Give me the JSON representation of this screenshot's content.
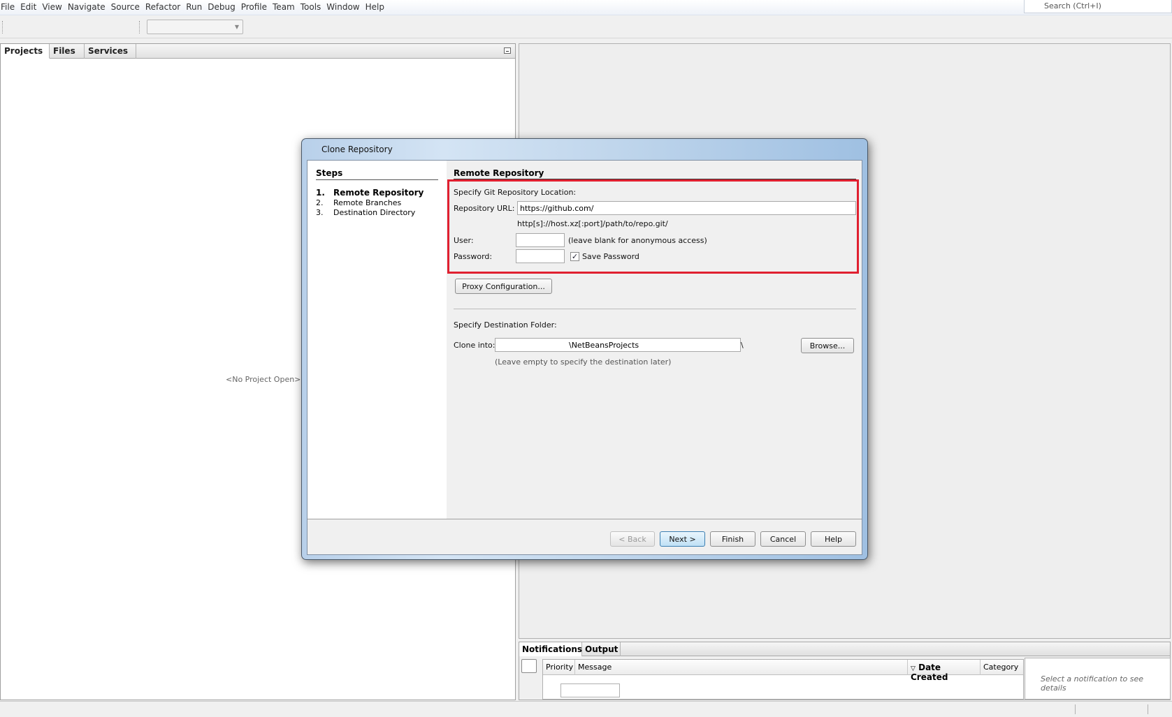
{
  "menu": {
    "items": [
      "File",
      "Edit",
      "View",
      "Navigate",
      "Source",
      "Refactor",
      "Run",
      "Debug",
      "Profile",
      "Team",
      "Tools",
      "Window",
      "Help"
    ]
  },
  "search": {
    "placeholder": "Search (Ctrl+I)"
  },
  "projects_panel": {
    "tabs": [
      "Projects",
      "Files",
      "Services"
    ],
    "empty_text": "<No Project Open>"
  },
  "dialog": {
    "title": "Clone Repository",
    "steps_title": "Steps",
    "steps": [
      {
        "num": "1.",
        "label": "Remote Repository"
      },
      {
        "num": "2.",
        "label": "Remote Branches"
      },
      {
        "num": "3.",
        "label": "Destination Directory"
      }
    ],
    "section_title": "Remote Repository",
    "specify_location": "Specify Git Repository Location:",
    "repo_url_label": "Repository URL:",
    "repo_url_value": "https://github.com/",
    "url_hint": "http[s]://host.xz[:port]/path/to/repo.git/",
    "user_label": "User:",
    "user_value": "",
    "user_hint": "(leave blank for anonymous access)",
    "password_label": "Password:",
    "password_value": "",
    "save_password_label": "Save Password",
    "save_password_checked": true,
    "proxy_button": "Proxy Configuration...",
    "destination_title": "Specify Destination Folder:",
    "clone_into_label": "Clone into:",
    "clone_into_value": "\\NetBeansProjects",
    "clone_into_suffix": "\\",
    "browse_button": "Browse...",
    "destination_hint": "(Leave empty to specify the destination later)",
    "buttons": {
      "back": "< Back",
      "next": "Next >",
      "finish": "Finish",
      "cancel": "Cancel",
      "help": "Help"
    },
    "highlight_color": "#e02030"
  },
  "notifications": {
    "tabs": [
      "Notifications",
      "Output"
    ],
    "columns": [
      "Priority",
      "Message",
      "Date Created",
      "Category"
    ],
    "detail_placeholder": "Select a notification to see details"
  }
}
